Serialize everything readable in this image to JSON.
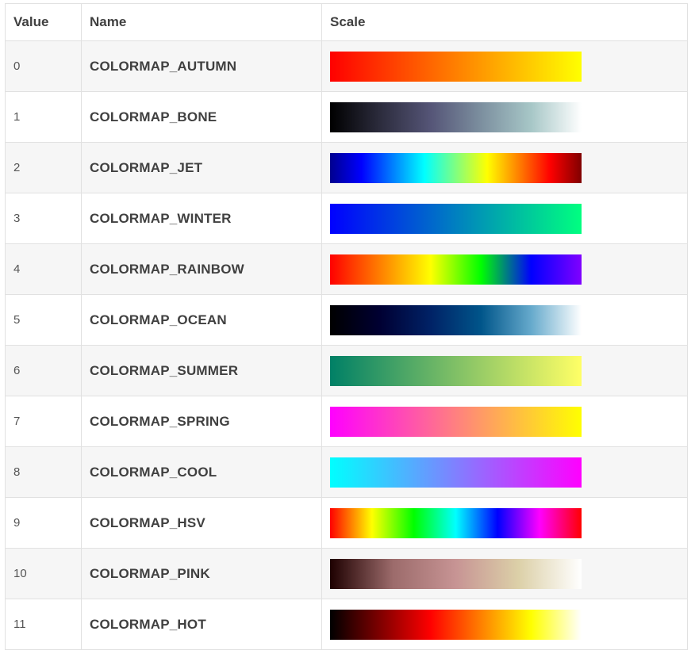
{
  "table": {
    "headers": {
      "value": "Value",
      "name": "Name",
      "scale": "Scale"
    },
    "rows": [
      {
        "value": "0",
        "name": "COLORMAP_AUTUMN",
        "icon": "autumn-colormap-bar",
        "gradient": [
          "#ff0000",
          "#ff5500",
          "#ffaa00",
          "#ffff00"
        ]
      },
      {
        "value": "1",
        "name": "COLORMAP_BONE",
        "icon": "bone-colormap-bar",
        "gradient": [
          "#000000",
          "#2c2c3d",
          "#555577",
          "#7c8f9f",
          "#a7c7c7",
          "#ffffff"
        ]
      },
      {
        "value": "2",
        "name": "COLORMAP_JET",
        "icon": "jet-colormap-bar",
        "gradient": [
          "#00008f",
          "#0000ff",
          "#0080ff",
          "#00ffff",
          "#80ff80",
          "#ffff00",
          "#ff8000",
          "#ff0000",
          "#800000"
        ]
      },
      {
        "value": "3",
        "name": "COLORMAP_WINTER",
        "icon": "winter-colormap-bar",
        "gradient": [
          "#0000ff",
          "#0080c0",
          "#00ff80"
        ]
      },
      {
        "value": "4",
        "name": "COLORMAP_RAINBOW",
        "icon": "rainbow-colormap-bar",
        "gradient": [
          "#ff0000",
          "#ff8000",
          "#ffff00",
          "#00ff00",
          "#0000ff",
          "#8000ff"
        ]
      },
      {
        "value": "5",
        "name": "COLORMAP_OCEAN",
        "icon": "ocean-colormap-bar",
        "gradient": [
          "#000000",
          "#000033",
          "#002266",
          "#00558a",
          "#66aacc",
          "#ffffff"
        ]
      },
      {
        "value": "6",
        "name": "COLORMAP_SUMMER",
        "icon": "summer-colormap-bar",
        "gradient": [
          "#008066",
          "#80c066",
          "#ffff66"
        ]
      },
      {
        "value": "7",
        "name": "COLORMAP_SPRING",
        "icon": "spring-colormap-bar",
        "gradient": [
          "#ff00ff",
          "#ff8080",
          "#ffff00"
        ]
      },
      {
        "value": "8",
        "name": "COLORMAP_COOL",
        "icon": "cool-colormap-bar",
        "gradient": [
          "#00ffff",
          "#8080ff",
          "#ff00ff"
        ]
      },
      {
        "value": "9",
        "name": "COLORMAP_HSV",
        "icon": "hsv-colormap-bar",
        "gradient": [
          "#ff0000",
          "#ffff00",
          "#00ff00",
          "#00ffff",
          "#0000ff",
          "#ff00ff",
          "#ff0000"
        ]
      },
      {
        "value": "10",
        "name": "COLORMAP_PINK",
        "icon": "pink-colormap-bar",
        "gradient": [
          "#1e0000",
          "#9c6b6b",
          "#c79494",
          "#dcd0a8",
          "#ffffff"
        ]
      },
      {
        "value": "11",
        "name": "COLORMAP_HOT",
        "icon": "hot-colormap-bar",
        "gradient": [
          "#000000",
          "#800000",
          "#ff0000",
          "#ff8000",
          "#ffff00",
          "#ffffff"
        ]
      }
    ]
  }
}
